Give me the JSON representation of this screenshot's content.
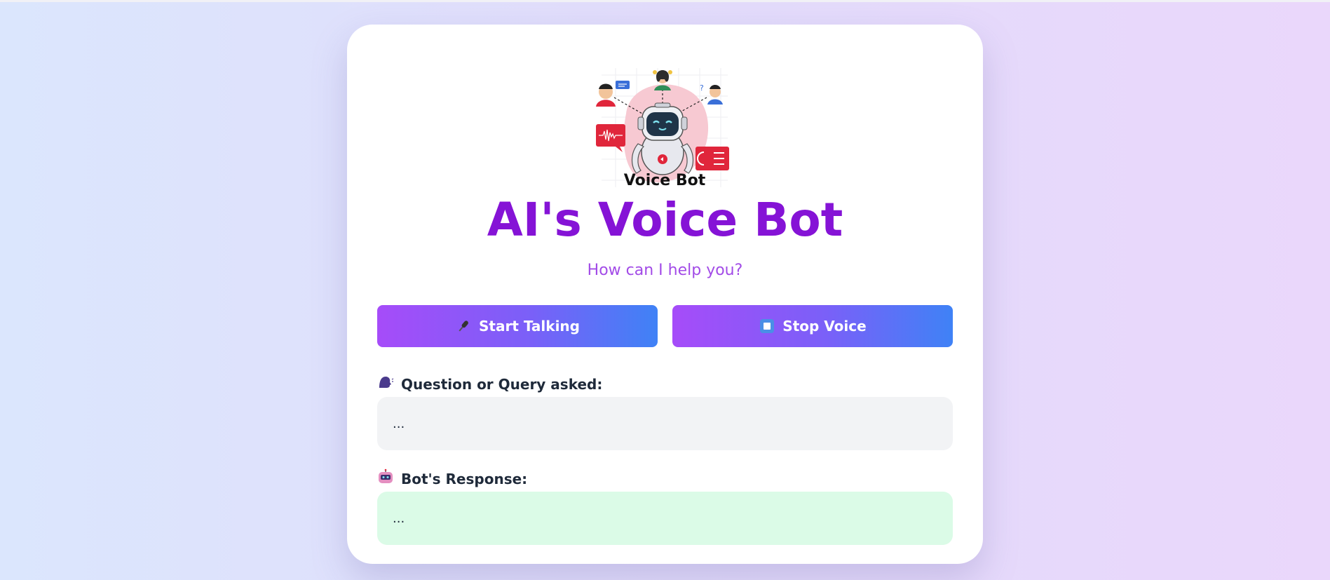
{
  "illustration": {
    "caption": "Voice Bot"
  },
  "header": {
    "title": "AI's Voice Bot",
    "subtitle": "How can I help you?"
  },
  "buttons": {
    "start_label": "Start Talking",
    "start_icon": "microphone-icon",
    "stop_label": "Stop Voice",
    "stop_icon": "stop-square-icon"
  },
  "question": {
    "label": "Question or Query asked:",
    "icon": "speaking-head-icon",
    "value": "..."
  },
  "response": {
    "label": "Bot's Response:",
    "icon": "robot-icon",
    "value": "..."
  },
  "colors": {
    "title": "#8513d6",
    "subtitle": "#a24be7",
    "button_gradient_start": "#a64cf9",
    "button_gradient_end": "#3f82f6",
    "question_box": "#f2f3f5",
    "response_box": "#dbfbe7"
  }
}
